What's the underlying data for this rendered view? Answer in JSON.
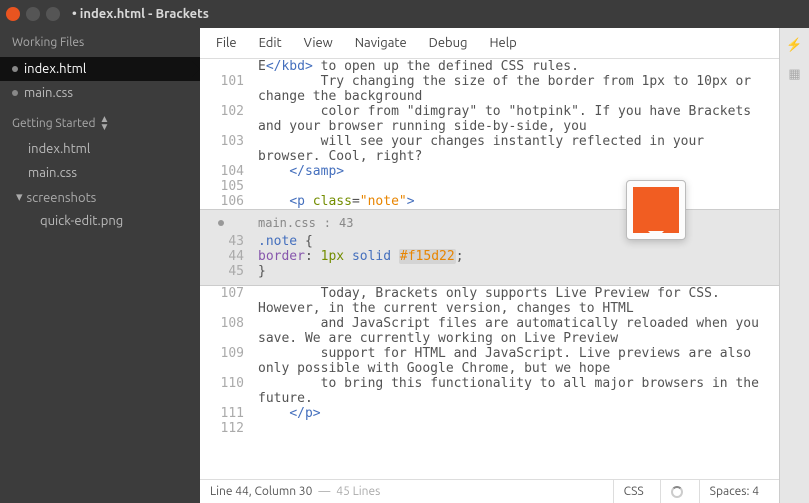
{
  "titlebar": {
    "title": "• index.html - Brackets"
  },
  "sidebar": {
    "working_files_label": "Working Files",
    "items": [
      {
        "name": "index.html",
        "dirty": true,
        "active": true
      },
      {
        "name": "main.css",
        "dirty": true,
        "active": false
      }
    ],
    "project_label": "Getting Started",
    "tree": {
      "files": [
        "index.html",
        "main.css"
      ],
      "folder": "screenshots",
      "folder_children": [
        "quick-edit.png"
      ]
    }
  },
  "menu": [
    "File",
    "Edit",
    "View",
    "Navigate",
    "Debug",
    "Help"
  ],
  "editor": {
    "top_lines": [
      {
        "n": "",
        "frag": "E</kbd> to open up the defined CSS rules."
      },
      {
        "n": "101",
        "frag": "        Try changing the size of the border from 1px to 10px or change the background"
      },
      {
        "n": "102",
        "frag": "        color from \"dimgray\" to \"hotpink\". If you have Brackets and your browser running side-by-side, you"
      },
      {
        "n": "103",
        "frag": "        will see your changes instantly reflected in your browser. Cool, right?"
      },
      {
        "n": "104",
        "frag": "    </samp>"
      },
      {
        "n": "105",
        "frag": ""
      },
      {
        "n": "106",
        "frag": "    <p class=\"note\">"
      }
    ],
    "inline": {
      "file": "main.css",
      "lineno": "43",
      "lines": [
        {
          "n": "43",
          "frag": ".note {"
        },
        {
          "n": "44",
          "frag": "    border: 1px solid #f15d22;"
        },
        {
          "n": "45",
          "frag": "}"
        }
      ],
      "swatch_color": "#f15d22"
    },
    "bottom_lines": [
      {
        "n": "107",
        "frag": "        Today, Brackets only supports Live Preview for CSS. However, in the current version, changes to HTML"
      },
      {
        "n": "108",
        "frag": "        and JavaScript files are automatically reloaded when you save. We are currently working on Live Preview"
      },
      {
        "n": "109",
        "frag": "        support for HTML and JavaScript. Live previews are also only possible with Google Chrome, but we hope"
      },
      {
        "n": "110",
        "frag": "        to bring this functionality to all major browsers in the future."
      },
      {
        "n": "111",
        "frag": "    </p>"
      },
      {
        "n": "112",
        "frag": ""
      }
    ]
  },
  "statusbar": {
    "cursor": "Line 44, Column 30",
    "sep": "—",
    "linecount": "45 Lines",
    "lang": "CSS",
    "indent_label": "Spaces:",
    "indent_size": "4"
  }
}
